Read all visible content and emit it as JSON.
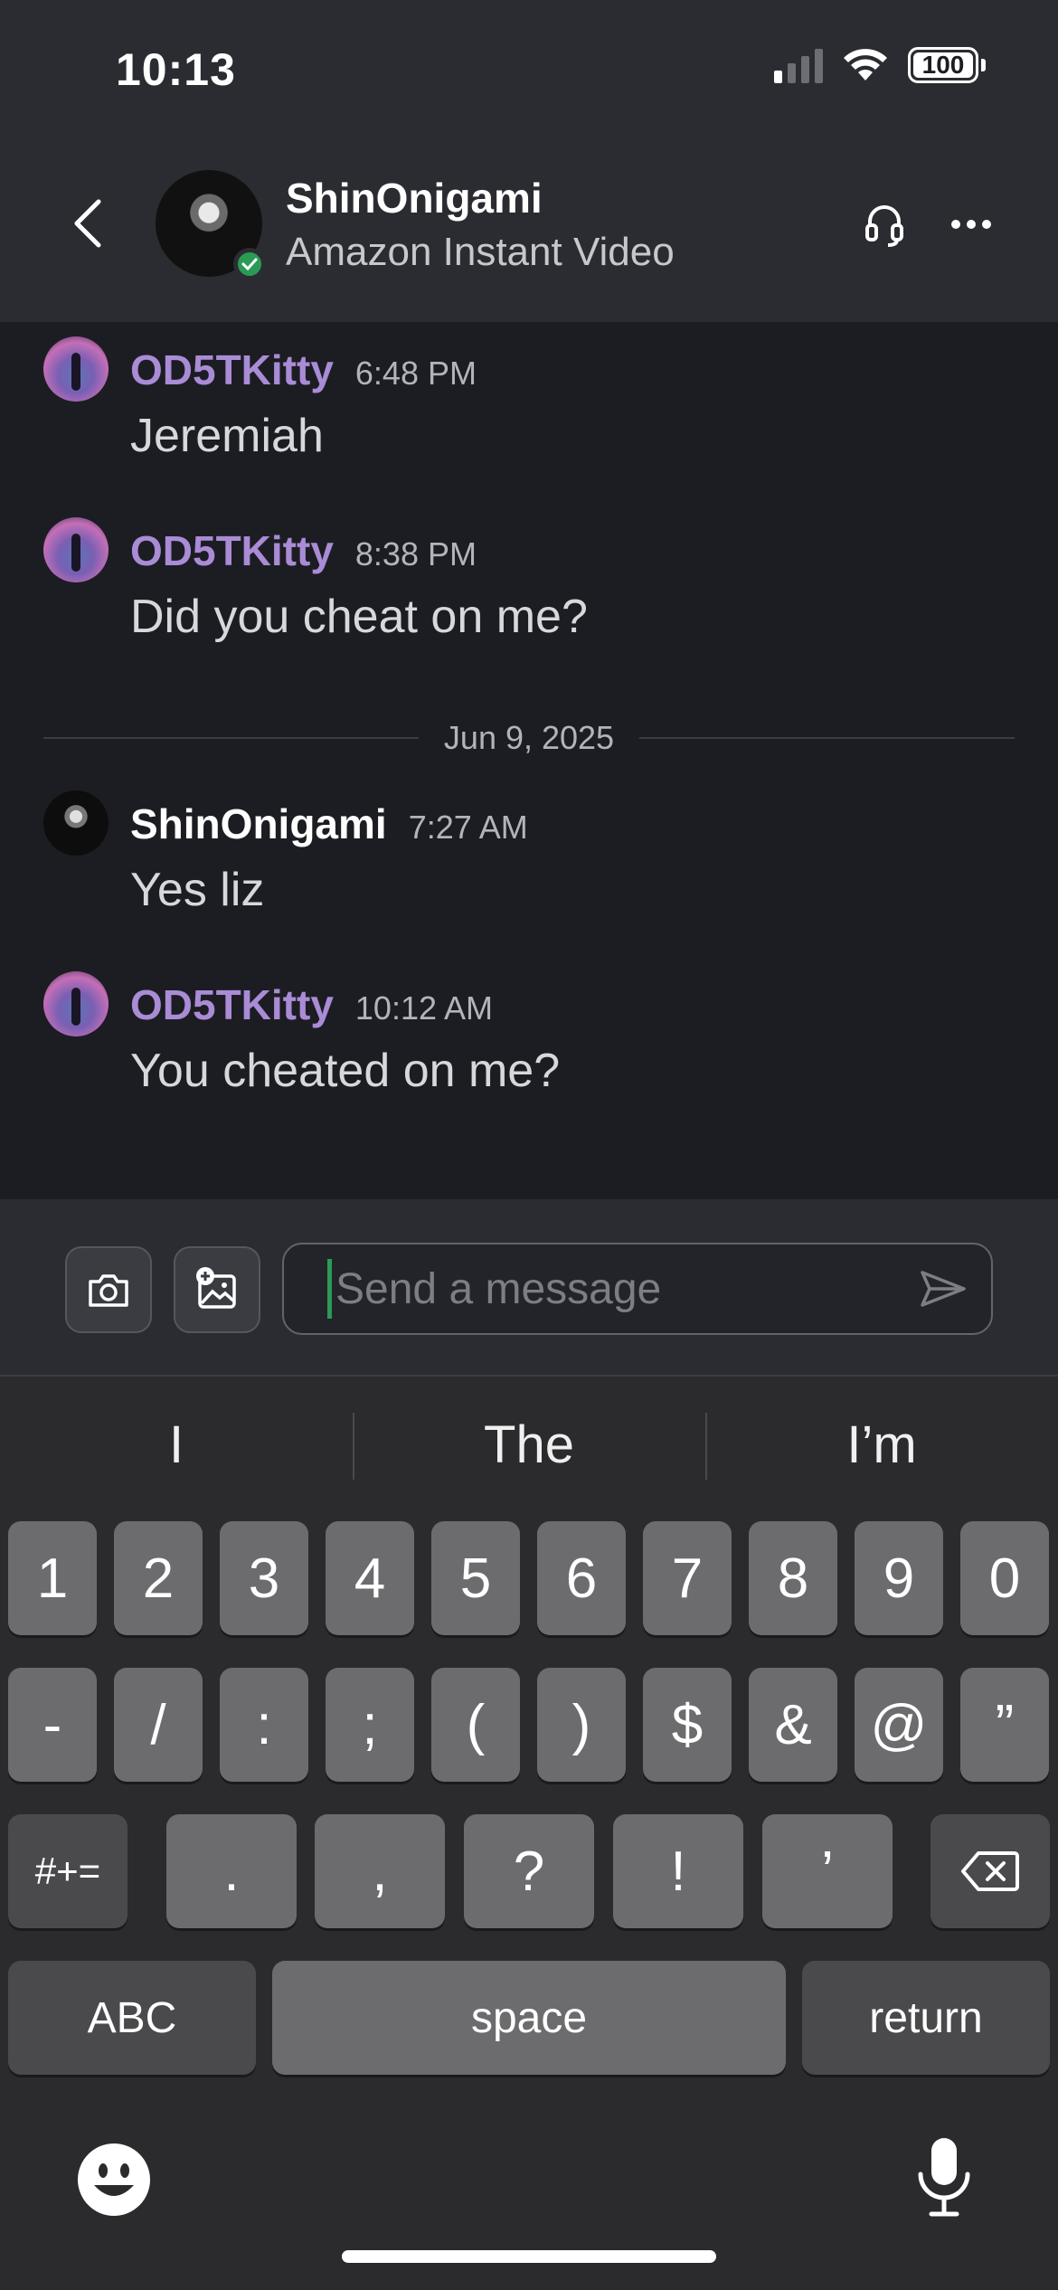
{
  "status_bar": {
    "time": "10:13",
    "battery": "100"
  },
  "header": {
    "name": "ShinOnigami",
    "subtitle": "Amazon Instant Video"
  },
  "messages": [
    {
      "author": "OD5TKitty",
      "time": "6:48 PM",
      "text": "Jeremiah"
    },
    {
      "author": "OD5TKitty",
      "time": "8:38 PM",
      "text": "Did you cheat on me?"
    },
    {
      "author": "ShinOnigami",
      "time": "7:27 AM",
      "text": "Yes liz"
    },
    {
      "author": "OD5TKitty",
      "time": "10:12 AM",
      "text": "You cheated on me?"
    }
  ],
  "date_separator": "Jun 9, 2025",
  "composer": {
    "placeholder": "Send a message"
  },
  "keyboard": {
    "predictions": [
      "I",
      "The",
      "I’m"
    ],
    "row1": [
      "1",
      "2",
      "3",
      "4",
      "5",
      "6",
      "7",
      "8",
      "9",
      "0"
    ],
    "row2": [
      "-",
      "/",
      ":",
      ";",
      "(",
      ")",
      "$",
      "&",
      "@",
      "”"
    ],
    "row3": {
      "mode": "#+=",
      "keys": [
        ".",
        ",",
        "?",
        "!",
        "’"
      ]
    },
    "row4": {
      "abc": "ABC",
      "space": "space",
      "return": "return"
    }
  },
  "colors": {
    "accent_online": "#2b9a55",
    "kitty_name": "#a98bd6"
  }
}
